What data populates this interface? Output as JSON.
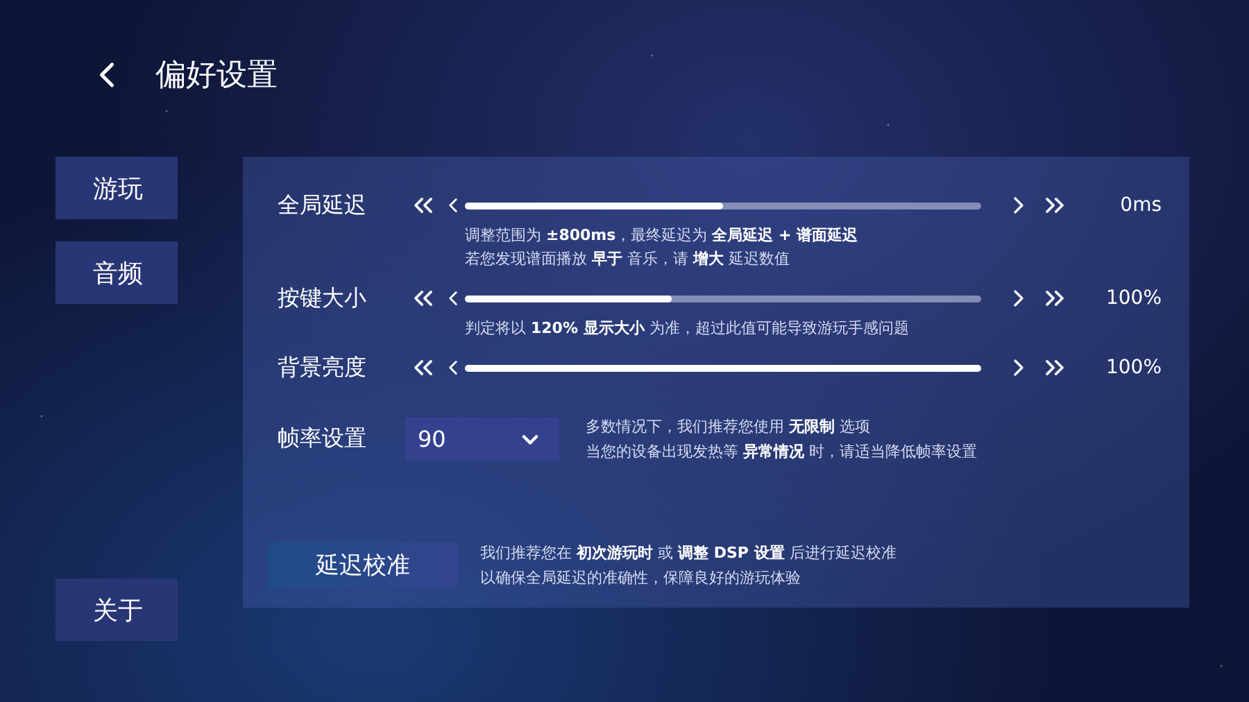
{
  "header": {
    "title": "偏好设置"
  },
  "sidebar": {
    "items": [
      {
        "label": "游玩"
      },
      {
        "label": "音频"
      },
      {
        "label": "关于"
      }
    ]
  },
  "settings": [
    {
      "kind": "slider",
      "label": "全局延迟",
      "level": 0.5,
      "value": "0ms",
      "hints": [
        "调整范围为 **±800ms**，最终延迟为 **全局延迟 + 谱面延迟**",
        "若您发现谱面播放 **早于** 音乐，请 **增大** 延迟数值"
      ]
    },
    {
      "kind": "slider",
      "label": "按键大小",
      "level": 0.4,
      "value": "100%",
      "hints": [
        "判定将以 **120% 显示大小** 为准，超过此值可能导致游玩手感问题"
      ]
    },
    {
      "kind": "slider",
      "label": "背景亮度",
      "level": 1,
      "value": "100%"
    },
    {
      "kind": "select",
      "label": "帧率设置",
      "value": "90",
      "hints": [
        "多数情况下，我们推荐您使用 **无限制** 选项",
        "当您的设备出现发热等 **异常情况** 时，请适当降低帧率设置"
      ]
    }
  ],
  "calibration": {
    "button": "延迟校准",
    "hints": [
      "我们推荐您在 **初次游玩时** 或 **调整 DSP 设置** 后进行延迟校准",
      "以确保全局延迟的准确性，保障良好的游玩体验"
    ]
  }
}
